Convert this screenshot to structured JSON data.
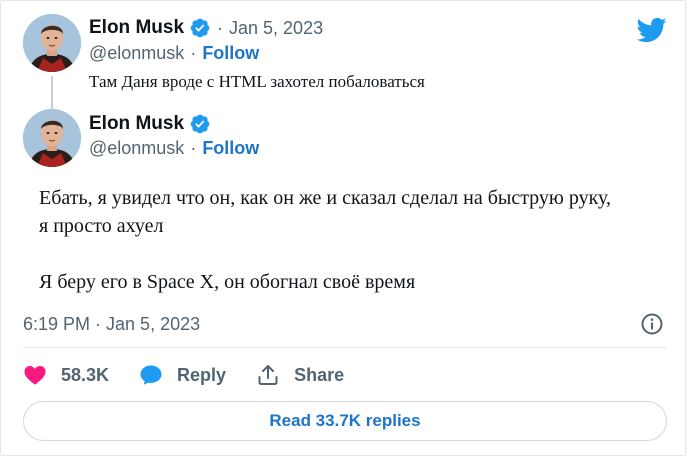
{
  "quoted_tweet": {
    "author_name": "Elon Musk",
    "date": "Jan 5, 2023",
    "dot": "·",
    "handle": "@elonmusk",
    "follow_label": "Follow",
    "text": "Там Даня вроде с HTML захотел побаловаться"
  },
  "main_tweet": {
    "author_name": "Elon Musk",
    "dot": "·",
    "handle": "@elonmusk",
    "follow_label": "Follow",
    "text_line1": "Ебать, я увидел что он, как он же и сказал сделал на быструю руку,",
    "text_line2": "я просто ахуел",
    "text_line3": "Я беру его в Space X, он обогнал своё время",
    "timestamp": "6:19 PM · Jan 5, 2023"
  },
  "actions": {
    "like_count": "58.3K",
    "reply_label": "Reply",
    "share_label": "Share"
  },
  "read_replies_label": "Read 33.7K replies",
  "icons": {
    "brand": "twitter-bird-icon",
    "verified": "verified-badge-icon",
    "like": "heart-icon",
    "reply": "speech-bubble-icon",
    "share": "share-upload-icon",
    "info": "info-icon"
  },
  "colors": {
    "brand_blue": "#1d9bf0",
    "link_blue": "#1d75c9",
    "like_pink": "#f91880",
    "muted_text": "#536471"
  }
}
